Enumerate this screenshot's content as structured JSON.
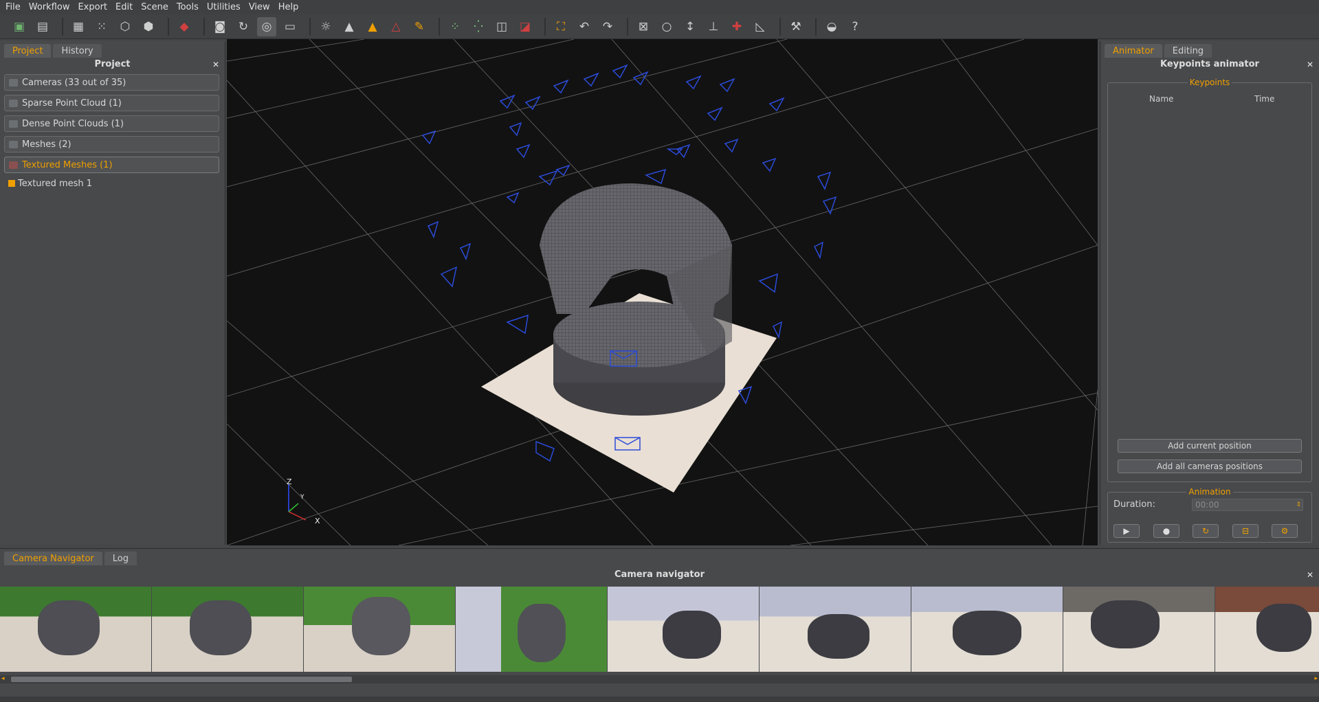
{
  "menu": [
    "File",
    "Workflow",
    "Export",
    "Edit",
    "Scene",
    "Tools",
    "Utilities",
    "View",
    "Help"
  ],
  "left": {
    "tabs": [
      "Project",
      "History"
    ],
    "title": "Project",
    "groups": [
      "Cameras (33 out of 35)",
      "Sparse Point Cloud (1)",
      "Dense Point Clouds (1)",
      "Meshes (2)",
      "Textured Meshes (1)"
    ],
    "mesh_item": "Textured mesh 1"
  },
  "right": {
    "tabs": [
      "Animator",
      "Editing"
    ],
    "title": "Keypoints animator",
    "keypoints_legend": "Keypoints",
    "columns": [
      "Name",
      "Time"
    ],
    "add_current": "Add current position",
    "add_all": "Add all cameras positions",
    "animation_legend": "Animation",
    "duration_label": "Duration:",
    "duration_value": "00:00"
  },
  "axes": {
    "z": "Z",
    "y": "Y",
    "x": "X"
  },
  "bottom": {
    "tabs": [
      "Camera Navigator",
      "Log"
    ],
    "title": "Camera navigator"
  },
  "colors": {
    "accent": "#f0a000",
    "camera": "#2b4bd8",
    "bg": "#454749"
  }
}
